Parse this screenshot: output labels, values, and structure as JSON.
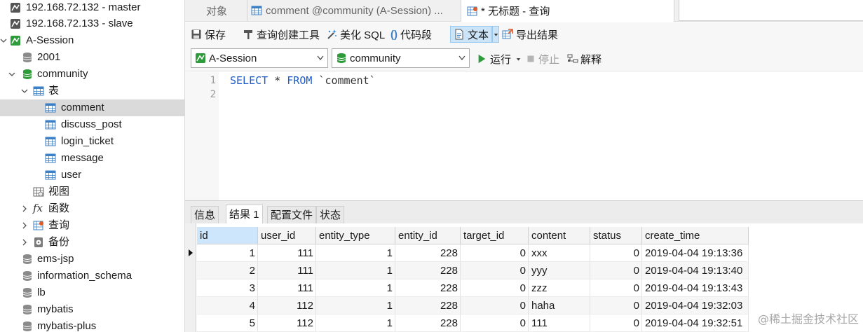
{
  "tree": {
    "nodes": [
      {
        "label": "192.168.72.132 - master"
      },
      {
        "label": "192.168.72.133 - slave"
      },
      {
        "label": "A-Session"
      },
      {
        "label": "2001"
      },
      {
        "label": "community"
      },
      {
        "label": "表"
      },
      {
        "label": "comment"
      },
      {
        "label": "discuss_post"
      },
      {
        "label": "login_ticket"
      },
      {
        "label": "message"
      },
      {
        "label": "user"
      },
      {
        "label": "视图"
      },
      {
        "label": "函数"
      },
      {
        "label": "查询"
      },
      {
        "label": "备份"
      },
      {
        "label": "ems-jsp"
      },
      {
        "label": "information_schema"
      },
      {
        "label": "lb"
      },
      {
        "label": "mybatis"
      },
      {
        "label": "mybatis-plus"
      }
    ]
  },
  "tabs": {
    "objects": "对象",
    "table_tab": "comment @community (A-Session) ...",
    "query_tab": "* 无标题 - 查询"
  },
  "toolbar": {
    "save": "保存",
    "query_builder": "查询创建工具",
    "beautify": "美化 SQL",
    "snippet": "代码段",
    "text": "文本",
    "export": "导出结果"
  },
  "selectors": {
    "connection": "A-Session",
    "database": "community",
    "run": "运行",
    "stop": "停止",
    "explain": "解释"
  },
  "editor": {
    "line_numbers": [
      "1",
      "2"
    ],
    "kw_select": "SELECT",
    "star": " * ",
    "kw_from": "FROM",
    "table": " `comment`"
  },
  "result_tabs": [
    "信息",
    "结果 1",
    "配置文件",
    "状态"
  ],
  "grid": {
    "columns": [
      "id",
      "user_id",
      "entity_type",
      "entity_id",
      "target_id",
      "content",
      "status",
      "create_time"
    ],
    "rows": [
      [
        "1",
        "111",
        "1",
        "228",
        "0",
        "xxx",
        "0",
        "2019-04-04 19:13:36"
      ],
      [
        "2",
        "111",
        "1",
        "228",
        "0",
        "yyy",
        "0",
        "2019-04-04 19:13:40"
      ],
      [
        "3",
        "111",
        "1",
        "228",
        "0",
        "zzz",
        "0",
        "2019-04-04 19:13:43"
      ],
      [
        "4",
        "112",
        "1",
        "228",
        "0",
        "haha",
        "0",
        "2019-04-04 19:32:03"
      ],
      [
        "5",
        "112",
        "1",
        "228",
        "0",
        "111",
        "0",
        "2019-04-04 19:32:51"
      ]
    ]
  },
  "watermark": "@稀土掘金技术社区",
  "colors": {
    "accent_green": "#2e9b3a",
    "keyword_blue": "#1e5cc8",
    "selection_bg": "#dadada",
    "header_selected": "#cde6fb"
  }
}
